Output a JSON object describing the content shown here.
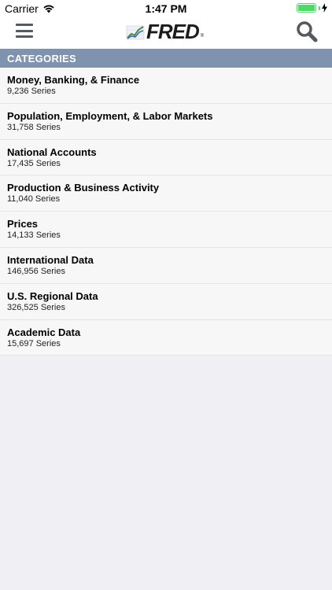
{
  "status_bar": {
    "carrier": "Carrier",
    "time": "1:47 PM",
    "battery_level": 1.0
  },
  "nav": {
    "logo_text": "FRED",
    "logo_mark": "®",
    "menu_icon": "hamburger-menu-icon",
    "search_icon": "search-icon"
  },
  "section": {
    "title": "CATEGORIES"
  },
  "categories": [
    {
      "title": "Money, Banking, & Finance",
      "count": "9,236 Series"
    },
    {
      "title": "Population, Employment, & Labor Markets",
      "count": "31,758 Series"
    },
    {
      "title": "National Accounts",
      "count": "17,435 Series"
    },
    {
      "title": "Production & Business Activity",
      "count": "11,040 Series"
    },
    {
      "title": "Prices",
      "count": "14,133 Series"
    },
    {
      "title": "International Data",
      "count": "146,956 Series"
    },
    {
      "title": "U.S. Regional Data",
      "count": "326,525 Series"
    },
    {
      "title": "Academic Data",
      "count": "15,697 Series"
    }
  ],
  "colors": {
    "header_bg": "#7f92ae",
    "battery": "#4cd964",
    "page_bg": "#efeff4"
  }
}
